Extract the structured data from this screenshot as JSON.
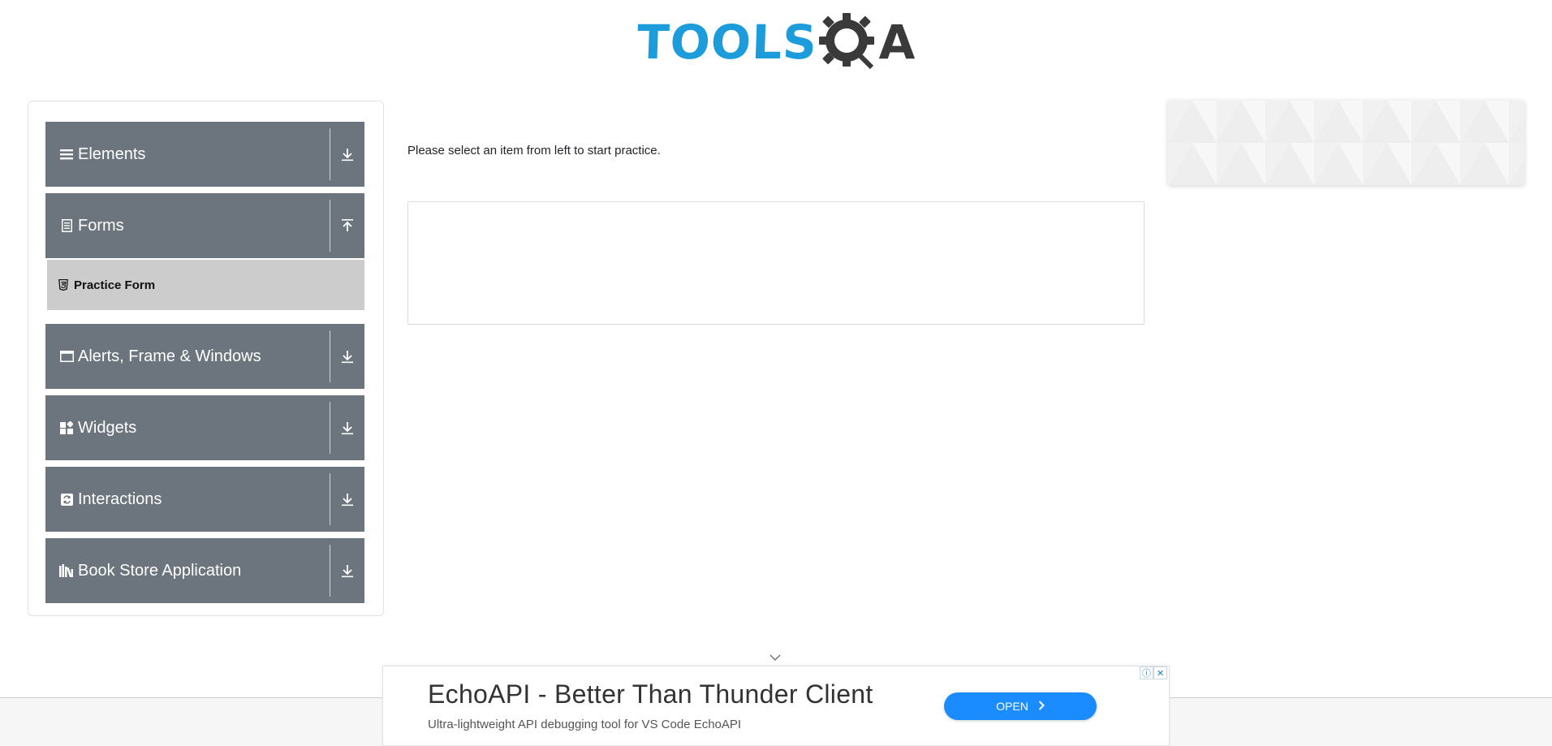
{
  "header": {
    "logo_text_primary": "TOOLS",
    "logo_text_secondary": "A"
  },
  "sidebar": {
    "groups": [
      {
        "label": "Elements",
        "icon": "list-icon",
        "expanded": false
      },
      {
        "label": "Forms",
        "icon": "form-icon",
        "expanded": true
      },
      {
        "label": "Alerts, Frame & Windows",
        "icon": "window-icon",
        "expanded": false
      },
      {
        "label": "Widgets",
        "icon": "widgets-icon",
        "expanded": false
      },
      {
        "label": "Interactions",
        "icon": "interactions-icon",
        "expanded": false
      },
      {
        "label": "Book Store Application",
        "icon": "books-icon",
        "expanded": false
      }
    ],
    "forms_items": [
      {
        "label": "Practice Form",
        "icon": "html5-icon"
      }
    ]
  },
  "main": {
    "instruction": "Please select an item from left to start practice."
  },
  "bottom_ad": {
    "title": "EchoAPI - Better Than Thunder Client",
    "subtitle": "Ultra-lightweight API debugging tool for VS Code EchoAPI",
    "button_label": "OPEN",
    "info_glyph": "ⓘ",
    "close_glyph": "✕"
  },
  "colors": {
    "sidebar_group_bg": "#6c757d",
    "sidebar_active_item_bg": "#cccccc",
    "logo_blue": "#1c9cdb",
    "logo_dark": "#3a3a3a",
    "ad_button": "#1a8cff"
  }
}
